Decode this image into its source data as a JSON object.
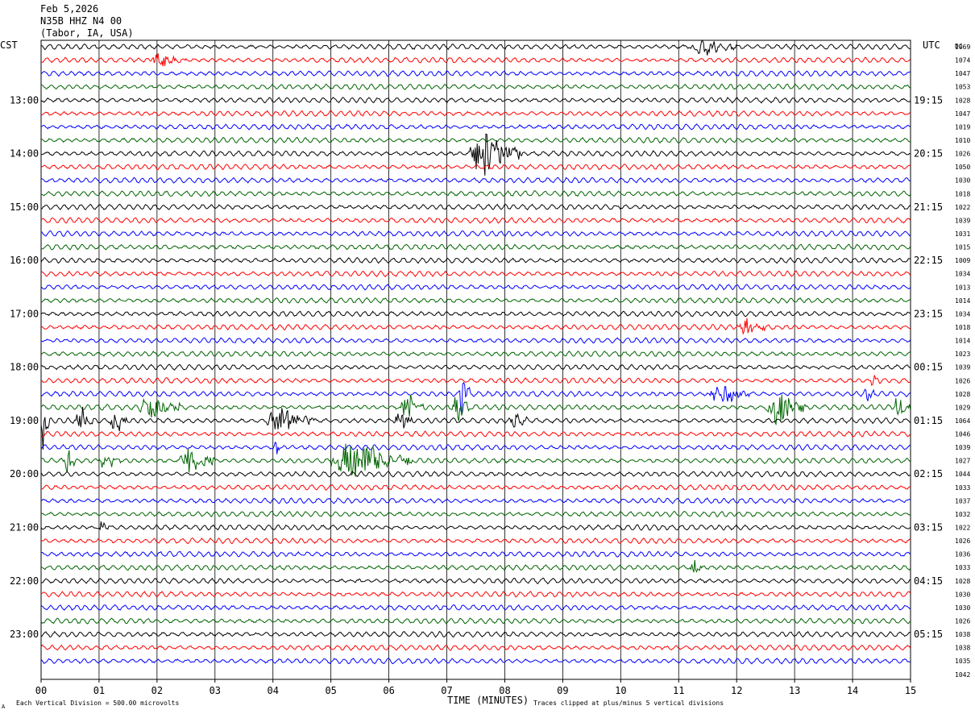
{
  "header": {
    "date": "Feb 5,2026",
    "station": "N35B HHZ N4 00",
    "location": "(Tabor, IA, USA)"
  },
  "labels": {
    "left_zone": "CST",
    "right_zone": "UTC",
    "dc_header": "DC",
    "xlabel": "TIME (MINUTES)",
    "scale_note": "Each Vertical Division =  500.00 microvolts",
    "clip_note": "Traces clipped at plus/minus 5 vertical divisions",
    "corner_mark": "A"
  },
  "colors": {
    "trace_cycle": [
      "#000000",
      "#ff0000",
      "#0000ff",
      "#006400"
    ],
    "grid": "#000000",
    "background": "#ffffff"
  },
  "chart_data": {
    "type": "line",
    "xlim": [
      0,
      15
    ],
    "x_ticks": [
      "00",
      "01",
      "02",
      "03",
      "04",
      "05",
      "06",
      "07",
      "08",
      "09",
      "10",
      "11",
      "12",
      "13",
      "14",
      "15"
    ],
    "trace_minutes": 15,
    "num_traces": 47,
    "left_hour_labels": [
      "13:00",
      "14:00",
      "15:00",
      "16:00",
      "17:00",
      "18:00",
      "19:00",
      "20:00",
      "21:00",
      "22:00",
      "23:00"
    ],
    "right_hour_labels": [
      "19:15",
      "20:15",
      "21:15",
      "22:15",
      "23:15",
      "00:15",
      "01:15",
      "02:15",
      "03:15",
      "04:15",
      "05:15"
    ],
    "first_hour_trace_index": 4,
    "traces_per_hour": 4,
    "dc_offsets": [
      "1069",
      "1074",
      "1047",
      "1053",
      "1028",
      "1047",
      "1019",
      "1010",
      "1026",
      "1050",
      "1030",
      "1018",
      "1022",
      "1039",
      "1031",
      "1015",
      "1009",
      "1034",
      "1013",
      "1014",
      "1034",
      "1018",
      "1014",
      "1023",
      "1039",
      "1026",
      "1028",
      "1029",
      "1064",
      "1046",
      "1039",
      "1027",
      "1044",
      "1033",
      "1037",
      "1032",
      "1022",
      "1026",
      "1036",
      "1033",
      "1028",
      "1030",
      "1030",
      "1026",
      "1038",
      "1038",
      "1035",
      "1042"
    ],
    "events": [
      {
        "trace": 0,
        "start_min": 11.2,
        "end_min": 12.0,
        "amp_div": 1.3
      },
      {
        "trace": 1,
        "start_min": 1.9,
        "end_min": 2.5,
        "amp_div": 1.2
      },
      {
        "trace": 8,
        "start_min": 7.4,
        "end_min": 8.3,
        "amp_div": 3.5
      },
      {
        "trace": 21,
        "start_min": 12.0,
        "end_min": 12.5,
        "amp_div": 1.4
      },
      {
        "trace": 25,
        "start_min": 14.3,
        "end_min": 14.5,
        "amp_div": 1.3
      },
      {
        "trace": 26,
        "start_min": 7.2,
        "end_min": 7.4,
        "amp_div": 3.0
      },
      {
        "trace": 26,
        "start_min": 11.5,
        "end_min": 12.3,
        "amp_div": 1.6
      },
      {
        "trace": 26,
        "start_min": 14.2,
        "end_min": 14.4,
        "amp_div": 1.2
      },
      {
        "trace": 27,
        "start_min": 1.7,
        "end_min": 2.4,
        "amp_div": 2.0
      },
      {
        "trace": 27,
        "start_min": 6.2,
        "end_min": 6.6,
        "amp_div": 2.0
      },
      {
        "trace": 27,
        "start_min": 7.1,
        "end_min": 7.4,
        "amp_div": 2.0
      },
      {
        "trace": 27,
        "start_min": 12.5,
        "end_min": 13.2,
        "amp_div": 2.5
      },
      {
        "trace": 27,
        "start_min": 14.7,
        "end_min": 15.0,
        "amp_div": 2.0
      },
      {
        "trace": 28,
        "start_min": 0.0,
        "end_min": 0.15,
        "amp_div": 5.0
      },
      {
        "trace": 28,
        "start_min": 0.6,
        "end_min": 0.9,
        "amp_div": 2.5
      },
      {
        "trace": 28,
        "start_min": 1.2,
        "end_min": 1.5,
        "amp_div": 2.0
      },
      {
        "trace": 28,
        "start_min": 3.9,
        "end_min": 4.7,
        "amp_div": 2.2
      },
      {
        "trace": 28,
        "start_min": 6.1,
        "end_min": 6.4,
        "amp_div": 2.0
      },
      {
        "trace": 28,
        "start_min": 8.1,
        "end_min": 8.4,
        "amp_div": 1.2
      },
      {
        "trace": 30,
        "start_min": 4.0,
        "end_min": 4.15,
        "amp_div": 1.5
      },
      {
        "trace": 31,
        "start_min": 0.4,
        "end_min": 0.6,
        "amp_div": 2.0
      },
      {
        "trace": 31,
        "start_min": 1.0,
        "end_min": 1.4,
        "amp_div": 1.5
      },
      {
        "trace": 31,
        "start_min": 2.4,
        "end_min": 3.0,
        "amp_div": 2.2
      },
      {
        "trace": 31,
        "start_min": 5.0,
        "end_min": 6.4,
        "amp_div": 2.8
      },
      {
        "trace": 36,
        "start_min": 1.0,
        "end_min": 1.2,
        "amp_div": 1.0
      },
      {
        "trace": 39,
        "start_min": 11.2,
        "end_min": 11.4,
        "amp_div": 1.2
      }
    ]
  }
}
